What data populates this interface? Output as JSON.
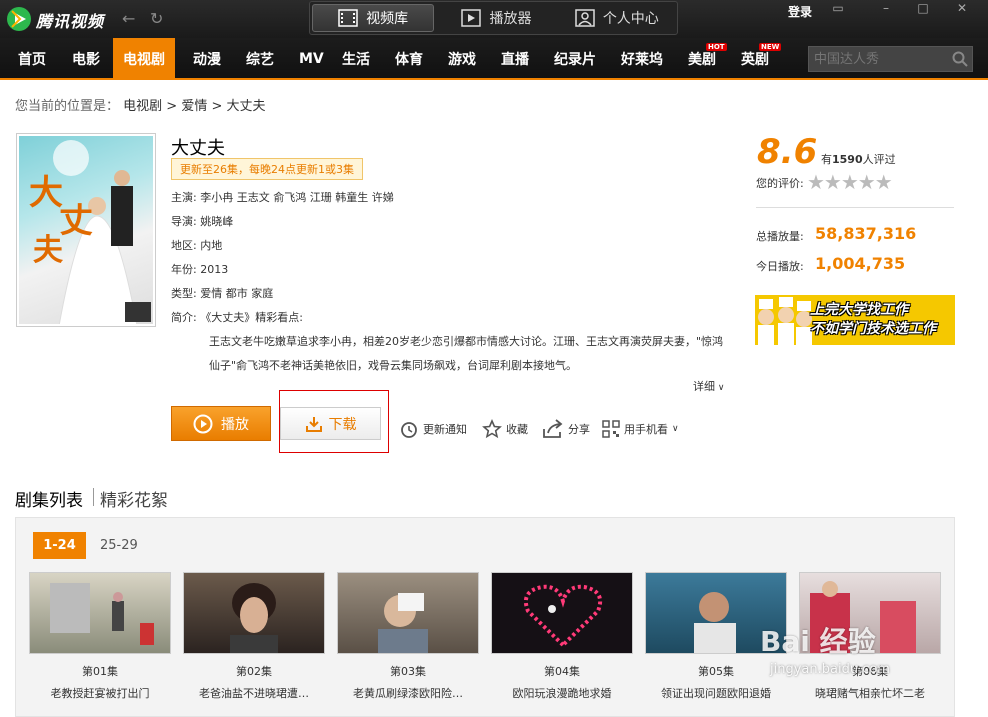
{
  "app": {
    "name": "腾讯视频",
    "login": "登录"
  },
  "top_tabs": [
    {
      "label": "视频库",
      "icon": "film-icon",
      "active": true
    },
    {
      "label": "播放器",
      "icon": "play-box-icon",
      "active": false
    },
    {
      "label": "个人中心",
      "icon": "user-icon",
      "active": false
    }
  ],
  "nav": [
    "首页",
    "电影",
    "电视剧",
    "动漫",
    "综艺",
    "MV",
    "生活",
    "体育",
    "游戏",
    "直播",
    "纪录片",
    "好莱坞",
    "美剧",
    "英剧"
  ],
  "nav_badges": {
    "hot": "HOT",
    "new": "NEW"
  },
  "search": {
    "placeholder": "中国达人秀"
  },
  "breadcrumb": {
    "prefix": "您当前的位置是：",
    "path": "电视剧 > 爱情 > 大丈夫"
  },
  "show": {
    "title": "大丈夫",
    "update": "更新至26集，每晚24点更新1或3集",
    "cast_k": "主演:",
    "cast": "李小冉 王志文 俞飞鸿 江珊 韩童生 许娣",
    "director_k": "导演:",
    "director": "姚晓峰",
    "region_k": "地区:",
    "region": "内地",
    "year_k": "年份:",
    "year": "2013",
    "genre_k": "类型:",
    "genre": "爱情 都市 家庭",
    "summary_k": "简介:",
    "summary_head": "《大丈夫》精彩看点:",
    "summary": "王志文老牛吃嫩草追求李小冉，相差20岁老少恋引爆都市情感大讨论。江珊、王志文再演荧屏夫妻，\"惊鸿仙子\"俞飞鸿不老神话美艳依旧，戏骨云集同场飙戏，台词犀利剧本接地气。",
    "more": "详细"
  },
  "rating": {
    "score": "8.6",
    "count_prefix": "有",
    "count": "1590",
    "count_suffix": "人评过",
    "your_rating": "您的评价:",
    "stars": "★★★★★"
  },
  "stats": {
    "total_label": "总播放量:",
    "total": "58,837,316",
    "today_label": "今日播放:",
    "today": "1,004,735"
  },
  "ad": {
    "line1": "上完大学找工作",
    "line2": "不如学门技术选工作"
  },
  "actions": {
    "play": "播放",
    "download": "下载",
    "notify": "更新通知",
    "favorite": "收藏",
    "share": "分享",
    "mobile": "用手机看"
  },
  "episodes": {
    "heading": "剧集列表",
    "heading2": "精彩花絮",
    "ranges": [
      "1-24",
      "25-29"
    ],
    "items": [
      {
        "no": "第01集",
        "title": "老教授赶宴被打出门"
      },
      {
        "no": "第02集",
        "title": "老爸油盐不进晓珺遭…"
      },
      {
        "no": "第03集",
        "title": "老黄瓜刷绿漆欧阳险…"
      },
      {
        "no": "第04集",
        "title": "欧阳玩浪漫跪地求婚"
      },
      {
        "no": "第05集",
        "title": "领证出现问题欧阳退婚"
      },
      {
        "no": "第06集",
        "title": "晓珺赌气相亲忙坏二老"
      }
    ]
  },
  "watermark": {
    "text": "Bai 经验",
    "url": "jingyan.baidu.com"
  },
  "colors": {
    "accent": "#f08200",
    "titlebar": "#1a1a1a"
  }
}
